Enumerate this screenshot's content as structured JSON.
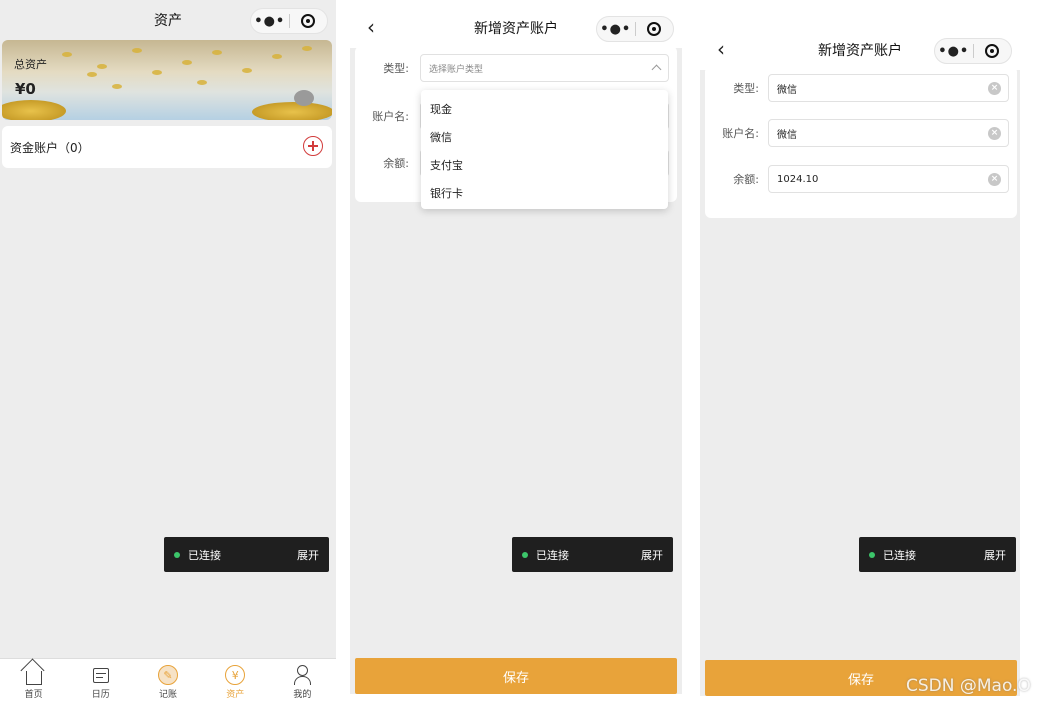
{
  "screen1": {
    "nav": {
      "title": "资产",
      "more": "•●•"
    },
    "banner": {
      "label": "总资产",
      "value": "¥0"
    },
    "accounts": {
      "label": "资金账户（0）"
    },
    "connection": {
      "status": "已连接",
      "expand": "展开"
    },
    "tabbar": [
      {
        "label": "首页",
        "icon": "home-icon"
      },
      {
        "label": "日历",
        "icon": "calendar-icon"
      },
      {
        "label": "记账",
        "icon": "pencil-icon"
      },
      {
        "label": "资产",
        "icon": "yuan-icon",
        "active": true
      },
      {
        "label": "我的",
        "icon": "user-icon"
      }
    ],
    "icon_glyphs": {
      "pen": "✎",
      "yuan": "¥"
    }
  },
  "screen2": {
    "nav": {
      "title": "新增资产账户",
      "back": "‹",
      "more": "•●•"
    },
    "form": {
      "type_label": "类型:",
      "type_placeholder": "选择账户类型",
      "name_label": "账户名:",
      "balance_label": "余额:"
    },
    "dropdown": [
      "现金",
      "微信",
      "支付宝",
      "银行卡"
    ],
    "connection": {
      "status": "已连接",
      "expand": "展开"
    },
    "save_label": "保存"
  },
  "screen3": {
    "nav": {
      "title": "新增资产账户",
      "back": "‹",
      "more": "•●•"
    },
    "form": {
      "type_label": "类型:",
      "type_value": "微信",
      "name_label": "账户名:",
      "name_value": "微信",
      "balance_label": "余额:",
      "balance_value": "1024.10",
      "clear_glyph": "×"
    },
    "connection": {
      "status": "已连接",
      "expand": "展开"
    },
    "save_label": "保存"
  },
  "watermark": "CSDN @Mao.O",
  "colors": {
    "accent": "#e8a33a",
    "add": "#d23c3c",
    "connected": "#3cc56a"
  }
}
